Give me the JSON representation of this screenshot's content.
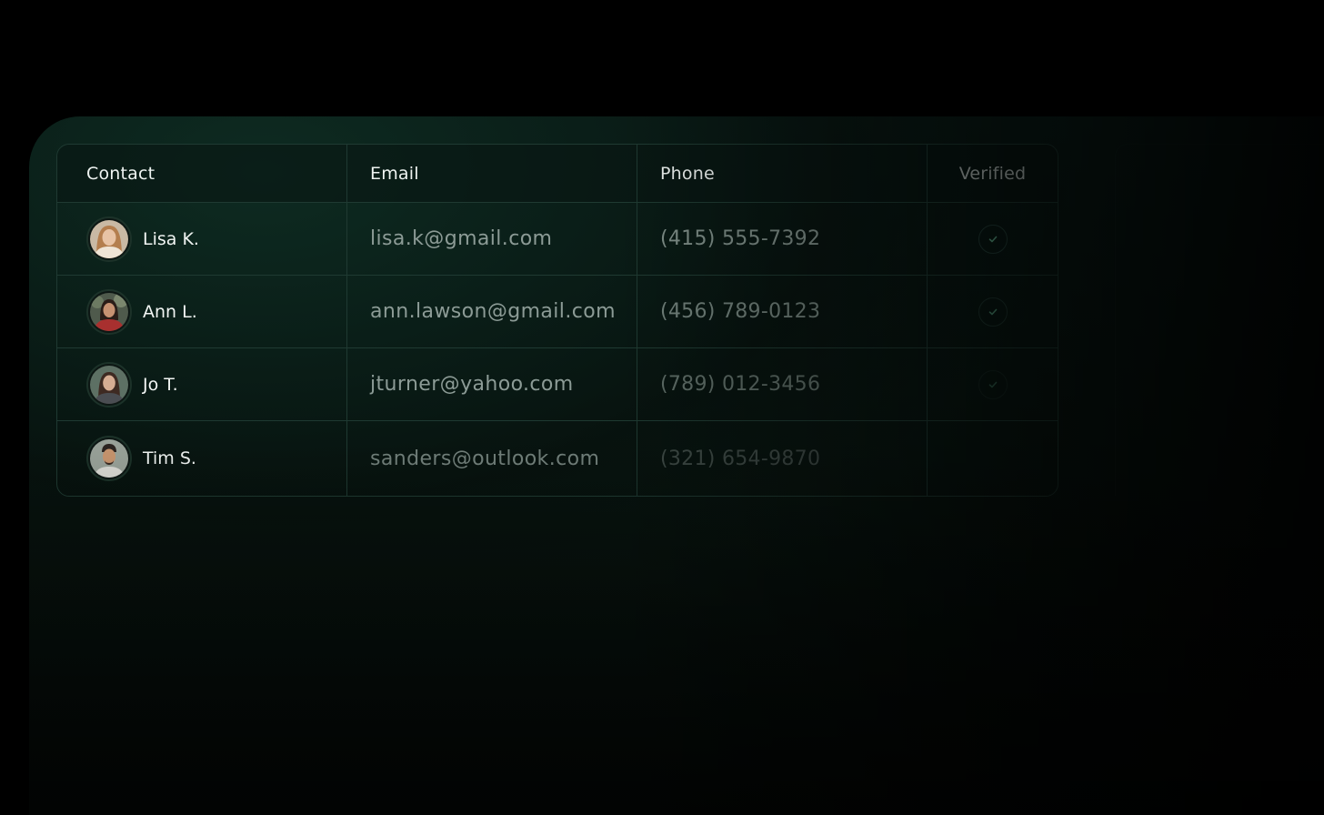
{
  "table": {
    "columns": [
      "Contact",
      "Email",
      "Phone",
      "Verified"
    ],
    "rows": [
      {
        "name": "Lisa K.",
        "email": "lisa.k@gmail.com",
        "phone": "(415) 555-7392",
        "verified": true,
        "avatar": "avatar-lisa"
      },
      {
        "name": "Ann L.",
        "email": "ann.lawson@gmail.com",
        "phone": "(456) 789-0123",
        "verified": true,
        "avatar": "avatar-ann"
      },
      {
        "name": "Jo T.",
        "email": "jturner@yahoo.com",
        "phone": "(789) 012-3456",
        "verified": true,
        "avatar": "avatar-jo"
      },
      {
        "name": "Tim S.",
        "email": "sanders@outlook.com",
        "phone": "(321) 654-9870",
        "verified": false,
        "avatar": "avatar-tim"
      }
    ]
  },
  "colors": {
    "background": "#000000",
    "panel": "#0b1e19",
    "border": "#1f3a32",
    "check": "#3f8f6f"
  },
  "icons": {
    "verified": "check-circle-icon"
  }
}
